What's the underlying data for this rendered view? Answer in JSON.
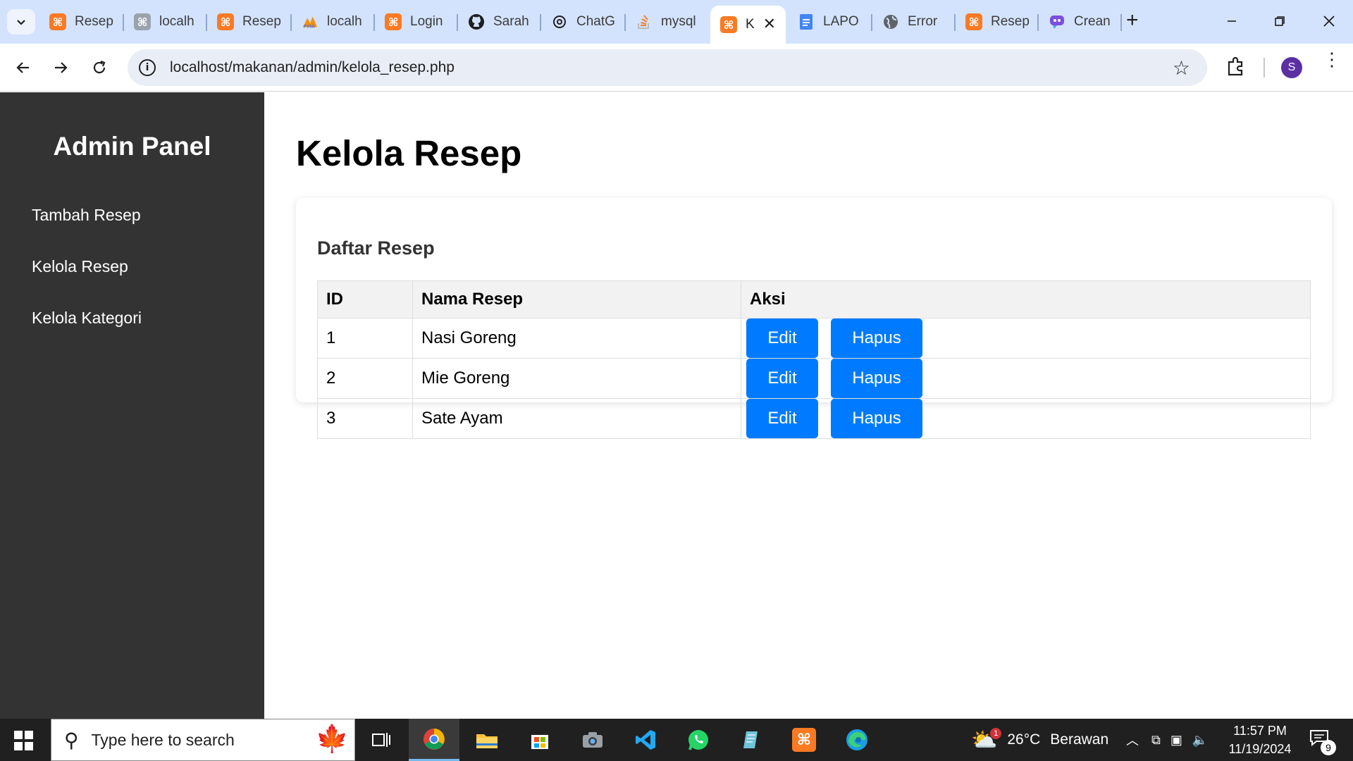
{
  "browser": {
    "tabs": [
      {
        "title": "Resep",
        "icon": "xampp-icon",
        "active": false
      },
      {
        "title": "localh",
        "icon": "xampp-icon",
        "active": false
      },
      {
        "title": "Resep",
        "icon": "xampp-icon",
        "active": false
      },
      {
        "title": "localh",
        "icon": "phpmyadmin-icon",
        "active": false
      },
      {
        "title": "Login",
        "icon": "xampp-icon",
        "active": false
      },
      {
        "title": "Sarah",
        "icon": "github-icon",
        "active": false
      },
      {
        "title": "ChatG",
        "icon": "chatgpt-icon",
        "active": false
      },
      {
        "title": "mysql",
        "icon": "stackoverflow-icon",
        "active": false
      },
      {
        "title": "K",
        "icon": "xampp-icon",
        "active": true
      },
      {
        "title": "LAPO",
        "icon": "google-docs-icon",
        "active": false
      },
      {
        "title": "Error",
        "icon": "globe-icon",
        "active": false
      },
      {
        "title": "Resep",
        "icon": "xampp-icon",
        "active": false
      },
      {
        "title": "Crean",
        "icon": "copilot-icon",
        "active": false
      }
    ],
    "url": "localhost/makanan/admin/kelola_resep.php",
    "profile_initial": "S"
  },
  "sidebar": {
    "title": "Admin Panel",
    "items": [
      {
        "label": "Tambah Resep"
      },
      {
        "label": "Kelola Resep"
      },
      {
        "label": "Kelola Kategori"
      }
    ]
  },
  "main": {
    "heading": "Kelola Resep",
    "card_title": "Daftar Resep",
    "table": {
      "headers": [
        "ID",
        "Nama Resep",
        "Aksi"
      ],
      "rows": [
        {
          "id": "1",
          "name": "Nasi Goreng",
          "edit": "Edit",
          "delete": "Hapus"
        },
        {
          "id": "2",
          "name": "Mie Goreng",
          "edit": "Edit",
          "delete": "Hapus"
        },
        {
          "id": "3",
          "name": "Sate Ayam",
          "edit": "Edit",
          "delete": "Hapus"
        }
      ]
    },
    "button_color": "#007bff"
  },
  "taskbar": {
    "search_placeholder": "Type here to search",
    "weather_temp": "26°C",
    "weather_desc": "Berawan",
    "weather_badge": "1",
    "time": "11:57 PM",
    "date": "11/19/2024",
    "notification_count": "9"
  }
}
